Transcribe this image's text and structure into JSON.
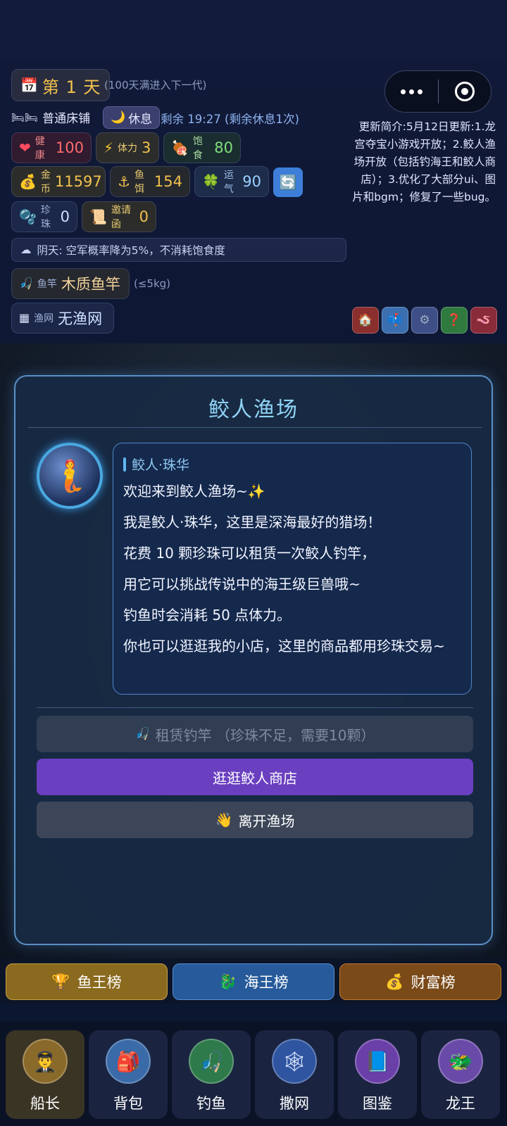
{
  "header": {
    "day": "第 1 天",
    "day_note": "(100天满进入下一代)",
    "bed": "普通床铺",
    "rest_button": "休息",
    "remaining": "剩余 19:27 (剩余休息1次)"
  },
  "stats": {
    "health": {
      "label": "健康",
      "value": "100"
    },
    "stamina": {
      "label": "体力",
      "value": "3"
    },
    "satiety": {
      "label": "饱食",
      "value": "80"
    },
    "gold": {
      "label": "金币",
      "value": "11597"
    },
    "bait": {
      "label": "鱼饵",
      "value": "154"
    },
    "luck": {
      "label": "运气",
      "value": "90"
    },
    "pearl": {
      "label": "珍珠",
      "value": "0"
    },
    "invite": {
      "label": "邀请函",
      "value": "0"
    }
  },
  "weather": "阴天: 空军概率降为5%，不消耗饱食度",
  "gear": {
    "rod": {
      "label": "鱼竿",
      "value": "木质鱼竿",
      "note": "(≤5kg)"
    },
    "net": {
      "label": "渔网",
      "value": "无渔网"
    }
  },
  "update_note": "更新简介:5月12日更新:1.龙宫夺宝小游戏开放；2.鲛人渔场开放（包括钓海王和鲛人商店）；3.优化了大部分ui、图片和bgm；修复了一些bug。",
  "dialog": {
    "title": "鲛人渔场",
    "speaker": "鲛人·珠华",
    "lines": [
      "欢迎来到鲛人渔场~✨",
      "我是鲛人·珠华，这里是深海最好的猎场！",
      "花费 10 颗珍珠可以租赁一次鲛人钓竿，",
      "用它可以挑战传说中的海王级巨兽哦~",
      "钓鱼时会消耗 50 点体力。",
      "你也可以逛逛我的小店，这里的商品都用珍珠交易~"
    ],
    "rent_button": "租赁钓竿 （珍珠不足，需要10颗）",
    "shop_button": "逛逛鲛人商店",
    "leave_button": "离开渔场"
  },
  "rankings": [
    "鱼王榜",
    "海王榜",
    "财富榜"
  ],
  "nav": [
    "船长",
    "背包",
    "钓鱼",
    "撒网",
    "图鉴",
    "龙王"
  ],
  "colors": {
    "gold": "#f2c14e",
    "accent": "#8fd3f5",
    "shop": "#6a3fc0"
  }
}
